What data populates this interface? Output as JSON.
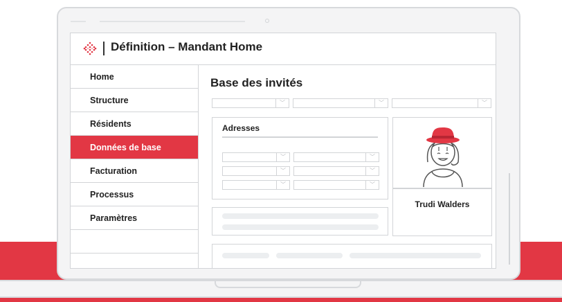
{
  "colors": {
    "accent": "#e23744",
    "border": "#d2d4d7",
    "text": "#222222"
  },
  "window": {
    "title": "Définition – Mandant Home",
    "logo_icon": "diamond-logo-icon"
  },
  "sidebar": {
    "items": [
      {
        "label": "Home"
      },
      {
        "label": "Structure"
      },
      {
        "label": "Résidents"
      },
      {
        "label": "Données de base",
        "active": true
      },
      {
        "label": "Facturation"
      },
      {
        "label": "Processus"
      },
      {
        "label": "Paramètres"
      }
    ]
  },
  "main": {
    "title": "Base des invités",
    "address_card": {
      "title": "Adresses"
    },
    "profile": {
      "name": "Trudi Walders",
      "avatar_icon": "avatar-illustration-icon"
    }
  }
}
